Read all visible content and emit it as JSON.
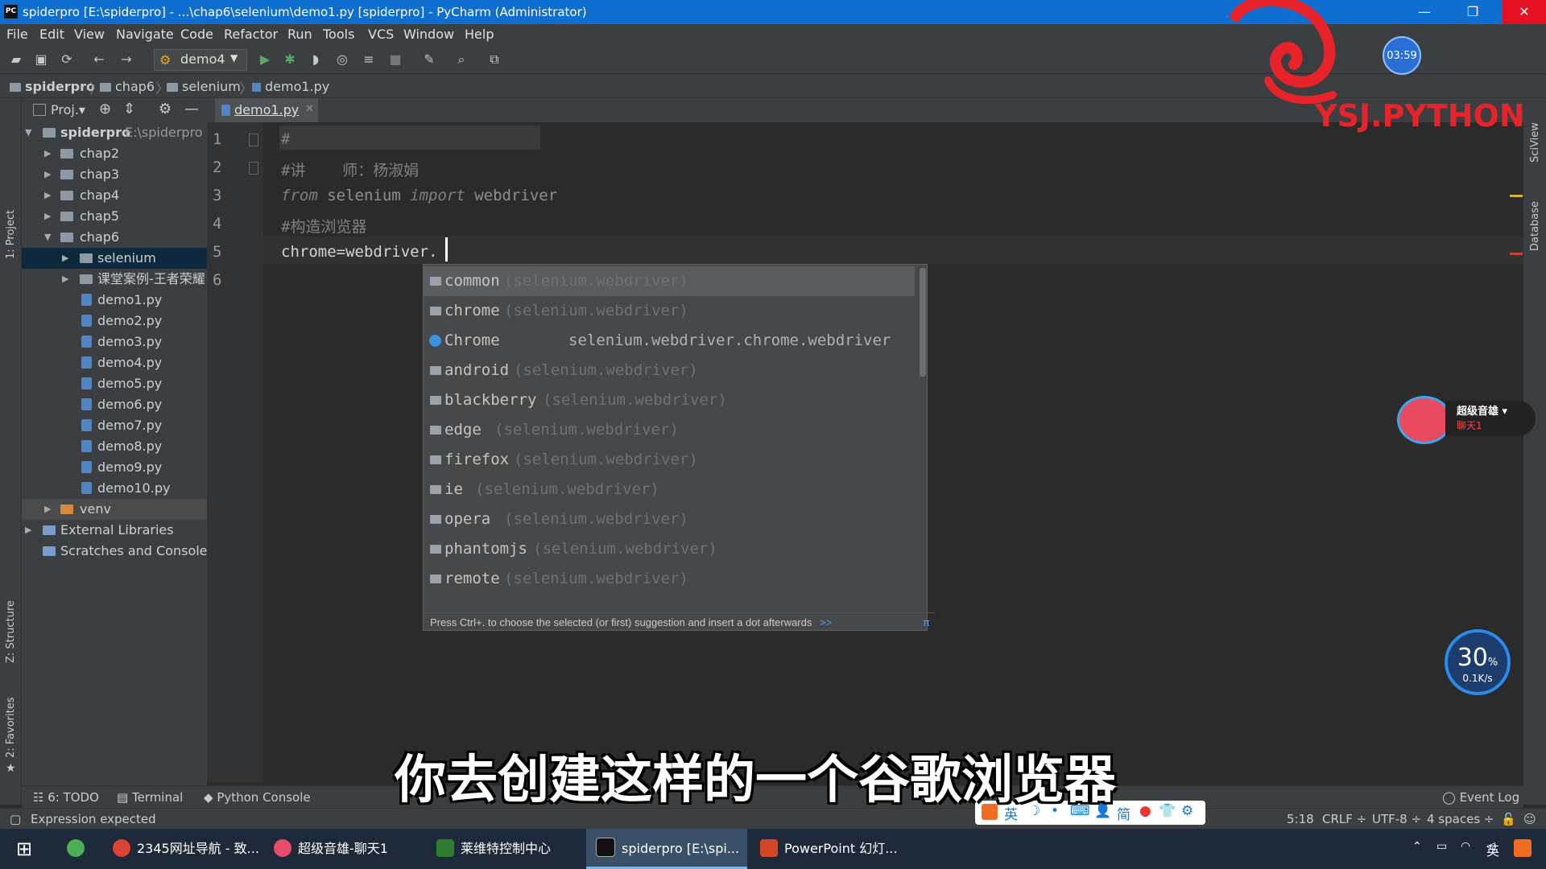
{
  "window": {
    "title": "spiderpro [E:\\spiderpro] - ...\\chap6\\selenium\\demo1.py [spiderpro] - PyCharm (Administrator)",
    "app_icon": "PC",
    "controls": [
      "—",
      "❐",
      "✕"
    ]
  },
  "menu": [
    "File",
    "Edit",
    "View",
    "Navigate",
    "Code",
    "Refactor",
    "Run",
    "Tools",
    "VCS",
    "Window",
    "Help"
  ],
  "toolbar": {
    "run_config": "demo4"
  },
  "breadcrumb": [
    "spiderpro",
    "chap6",
    "selenium",
    "demo1.py"
  ],
  "left_stripe": {
    "project": "1: Project",
    "structure": "Z: Structure",
    "favorites": "2: Favorites"
  },
  "project": {
    "header": "Proj.▾",
    "root": {
      "name": "spiderpro",
      "path": "E:\\spiderpro"
    },
    "folders": [
      "chap2",
      "chap3",
      "chap4",
      "chap5",
      "chap6"
    ],
    "chap6_children": [
      "selenium",
      "课堂案例-王者荣耀"
    ],
    "files": [
      "demo1.py",
      "demo2.py",
      "demo3.py",
      "demo4.py",
      "demo5.py",
      "demo6.py",
      "demo7.py",
      "demo8.py",
      "demo9.py",
      "demo10.py"
    ],
    "venv": "venv",
    "external": "External Libraries",
    "scratches": "Scratches and Consoles"
  },
  "editor": {
    "tab": "demo1.py",
    "line_numbers": [
      "1",
      "2",
      "3",
      "4",
      "5",
      "6"
    ],
    "lines": {
      "l1": "#",
      "l2": "#讲    师：杨淑娟",
      "l3_kw1": "from",
      "l3_mod": " selenium ",
      "l3_kw2": "import",
      "l3_name": " webdriver",
      "l4": "#构造浏览器",
      "l5": "chrome=webdriver."
    }
  },
  "completion": {
    "items": [
      {
        "name": "common",
        "module": "(selenium.webdriver)"
      },
      {
        "name": "chrome",
        "module": "(selenium.webdriver)"
      },
      {
        "name": "Chrome",
        "module": "selenium.webdriver.chrome.webdriver"
      },
      {
        "name": "android",
        "module": "(selenium.webdriver)"
      },
      {
        "name": "blackberry",
        "module": "(selenium.webdriver)"
      },
      {
        "name": "edge",
        "module": "(selenium.webdriver)"
      },
      {
        "name": "firefox",
        "module": "(selenium.webdriver)"
      },
      {
        "name": "ie",
        "module": "(selenium.webdriver)"
      },
      {
        "name": "opera",
        "module": "(selenium.webdriver)"
      },
      {
        "name": "phantomjs",
        "module": "(selenium.webdriver)"
      },
      {
        "name": "remote",
        "module": "(selenium.webdriver)"
      }
    ],
    "hint": "Press Ctrl+. to choose the selected (or first) suggestion and insert a dot afterwards",
    "hint_link": ">>",
    "pi": "π"
  },
  "right_stripe": {
    "sciview": "SciView",
    "database": "Database"
  },
  "bottom_tools": {
    "todo": "6: TODO",
    "terminal": "Terminal",
    "console": "Python Console",
    "eventlog": "Event Log"
  },
  "status": {
    "message": "Expression expected",
    "position": "5:18",
    "line_sep": "CRLF ÷",
    "encoding": "UTF-8 ÷",
    "indent": "4 spaces ÷"
  },
  "ime": [
    "英",
    "☽",
    "•",
    "⌨",
    "👤",
    "简",
    "●",
    "👕",
    "⚙"
  ],
  "taskbar": {
    "items": [
      "2345网址导航 - 致...",
      "超级音雄-聊天1",
      "莱维特控制中心",
      "spiderpro [E:\\spi...",
      "PowerPoint 幻灯..."
    ],
    "tray_lang": "英"
  },
  "overlays": {
    "subtitle": "你去创建这样的一个谷歌浏览器",
    "watermark": "YSJ.PYTHON",
    "clock": "03:59",
    "music_title": "超级音雄 ▾",
    "music_sub": "聊天1",
    "net_percent": "30",
    "net_speed": "0.1K/s"
  },
  "colors": {
    "accent": "#4a88c7",
    "titlebar": "#0f6fd0",
    "editor_bg": "#2b2b2b",
    "panel_bg": "#3c3f41",
    "watermark": "#e8232a"
  }
}
